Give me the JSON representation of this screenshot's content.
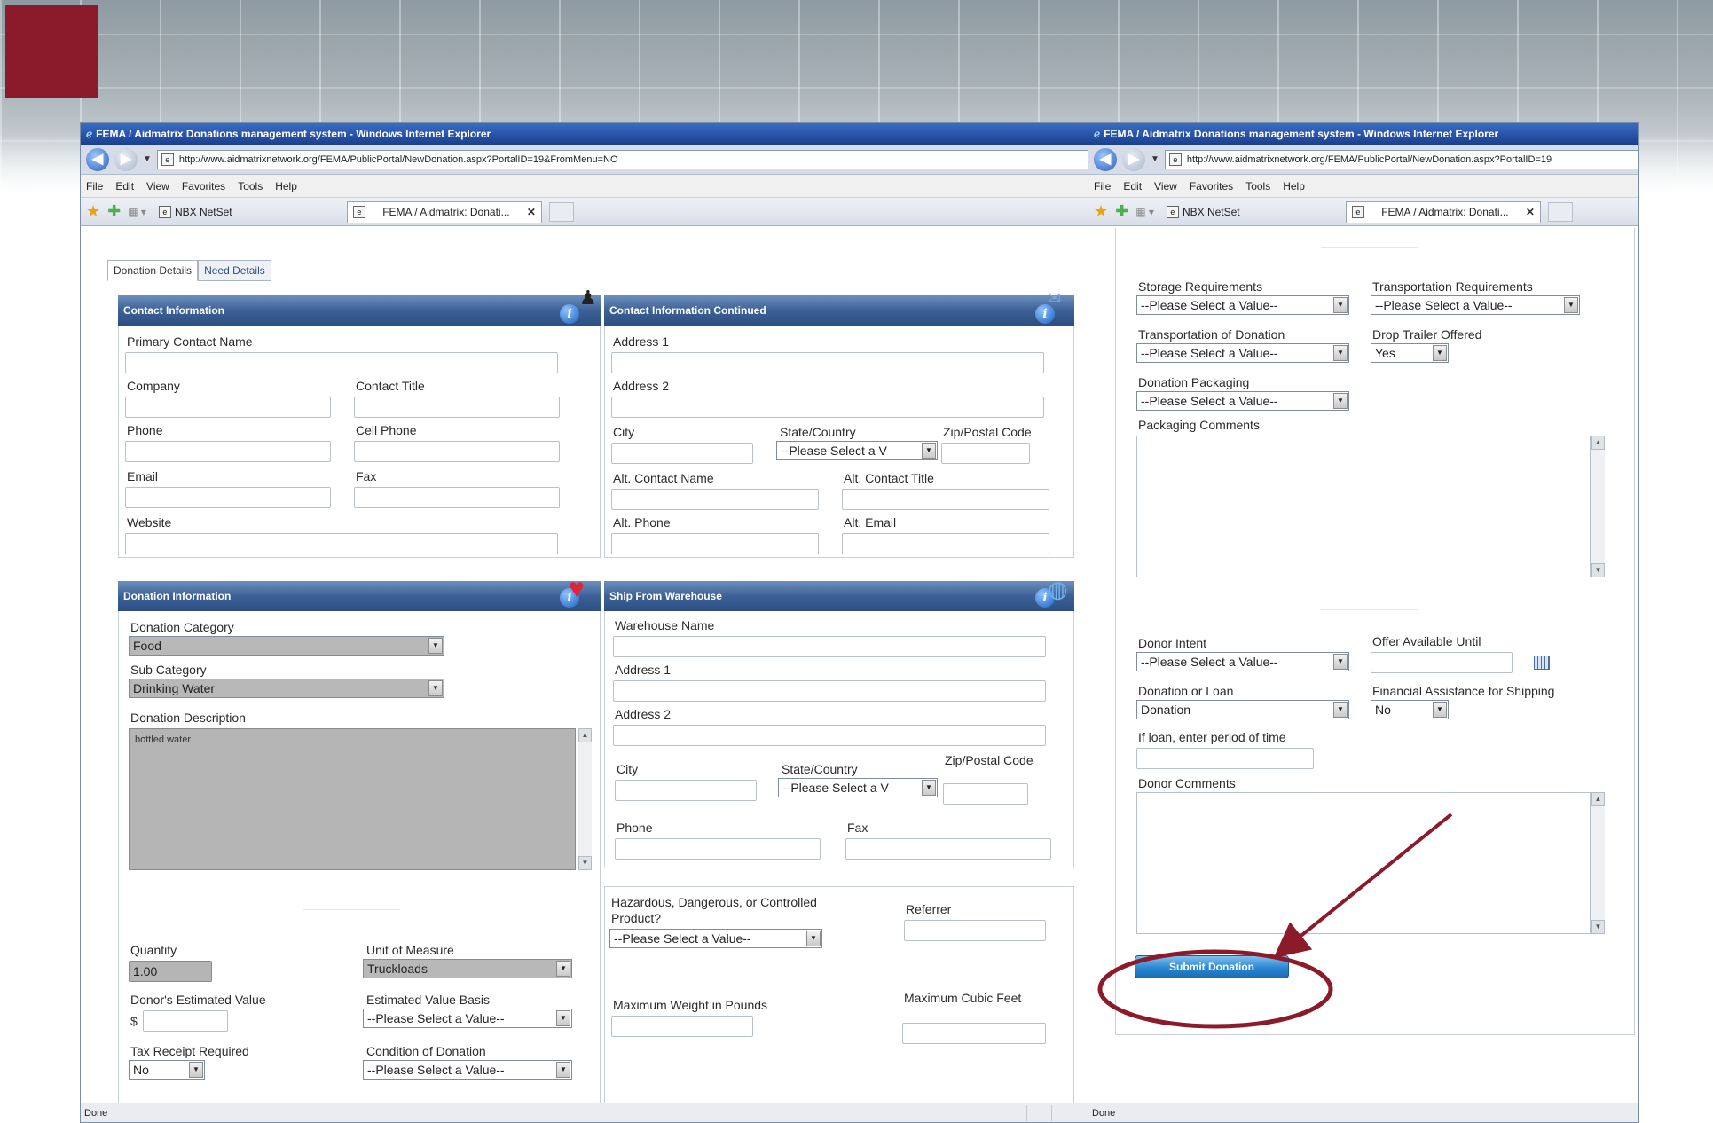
{
  "colors": {
    "brand": "#8b1a2b",
    "header_blue": "#2c4f83",
    "submit_blue": "#2a86d1",
    "annotation": "#8b1a2b"
  },
  "browser": {
    "title": "FEMA / Aidmatrix Donations management system - Windows Internet Explorer",
    "url": "http://www.aidmatrixnetwork.org/FEMA/PublicPortal/NewDonation.aspx?PortalID=19&FromMenu=NO",
    "url_right": "http://www.aidmatrixnetwork.org/FEMA/PublicPortal/NewDonation.aspx?PortalID=19",
    "menu": [
      "File",
      "Edit",
      "View",
      "Favorites",
      "Tools",
      "Help"
    ],
    "fav_tab": "NBX NetSet",
    "active_tab": "FEMA / Aidmatrix: Donati...",
    "status": "Done"
  },
  "tabs": {
    "donation_details": "Donation Details",
    "need_details": "Need Details"
  },
  "contact": {
    "header": "Contact Information",
    "primary_contact_name": "Primary Contact Name",
    "company": "Company",
    "contact_title": "Contact Title",
    "phone": "Phone",
    "cell_phone": "Cell Phone",
    "email": "Email",
    "fax": "Fax",
    "website": "Website"
  },
  "contact_cont": {
    "header": "Contact Information Continued",
    "address1": "Address 1",
    "address2": "Address 2",
    "city": "City",
    "state_country": "State/Country",
    "state_value": "--Please Select a V",
    "zip": "Zip/Postal Code",
    "alt_contact_name": "Alt. Contact Name",
    "alt_contact_title": "Alt. Contact Title",
    "alt_phone": "Alt. Phone",
    "alt_email": "Alt. Email"
  },
  "donation": {
    "header": "Donation Information",
    "category_label": "Donation Category",
    "category_value": "Food",
    "subcategory_label": "Sub Category",
    "subcategory_value": "Drinking Water",
    "description_label": "Donation Description",
    "description_value": "bottled water",
    "quantity_label": "Quantity",
    "quantity_value": "1.00",
    "unit_label": "Unit of Measure",
    "unit_value": "Truckloads",
    "est_value_label": "Donor's Estimated Value",
    "currency": "$",
    "basis_label": "Estimated Value Basis",
    "basis_value": "--Please Select a Value--",
    "tax_label": "Tax Receipt Required",
    "tax_value": "No",
    "condition_label": "Condition of Donation",
    "condition_value": "--Please Select a Value--"
  },
  "warehouse": {
    "header": "Ship From Warehouse",
    "name": "Warehouse Name",
    "address1": "Address 1",
    "address2": "Address 2",
    "city": "City",
    "state_country": "State/Country",
    "state_value": "--Please Select a V",
    "zip": "Zip/Postal Code",
    "phone": "Phone",
    "fax": "Fax"
  },
  "hazard": {
    "label_line1": "Hazardous, Dangerous, or Controlled",
    "label_line2": "Product?",
    "value": "--Please Select a Value--",
    "referrer": "Referrer",
    "max_weight": "Maximum Weight in Pounds",
    "max_cubic": "Maximum Cubic Feet"
  },
  "right": {
    "storage_label": "Storage Requirements",
    "storage_value": "--Please Select a Value--",
    "transport_req_label": "Transportation Requirements",
    "transport_req_value": "--Please Select a Value--",
    "transport_donation_label": "Transportation of Donation",
    "transport_donation_value": "--Please Select a Value--",
    "drop_trailer_label": "Drop Trailer Offered",
    "drop_trailer_value": "Yes",
    "packaging_label": "Donation Packaging",
    "packaging_value": "--Please Select a Value--",
    "packaging_comments": "Packaging Comments",
    "donor_intent_label": "Donor Intent",
    "donor_intent_value": "--Please Select a Value--",
    "offer_until_label": "Offer Available Until",
    "donation_loan_label": "Donation or Loan",
    "donation_loan_value": "Donation",
    "financial_label": "Financial Assistance for Shipping",
    "financial_value": "No",
    "loan_period_label": "If loan, enter period of time",
    "donor_comments": "Donor Comments",
    "submit": "Submit Donation"
  },
  "icons": [
    "back-arrow-icon",
    "forward-arrow-icon",
    "favorites-star-icon",
    "add-favorite-icon",
    "info-icon",
    "calendar-icon",
    "heart-icon",
    "globe-icon",
    "page-icon",
    "close-tab-icon"
  ]
}
